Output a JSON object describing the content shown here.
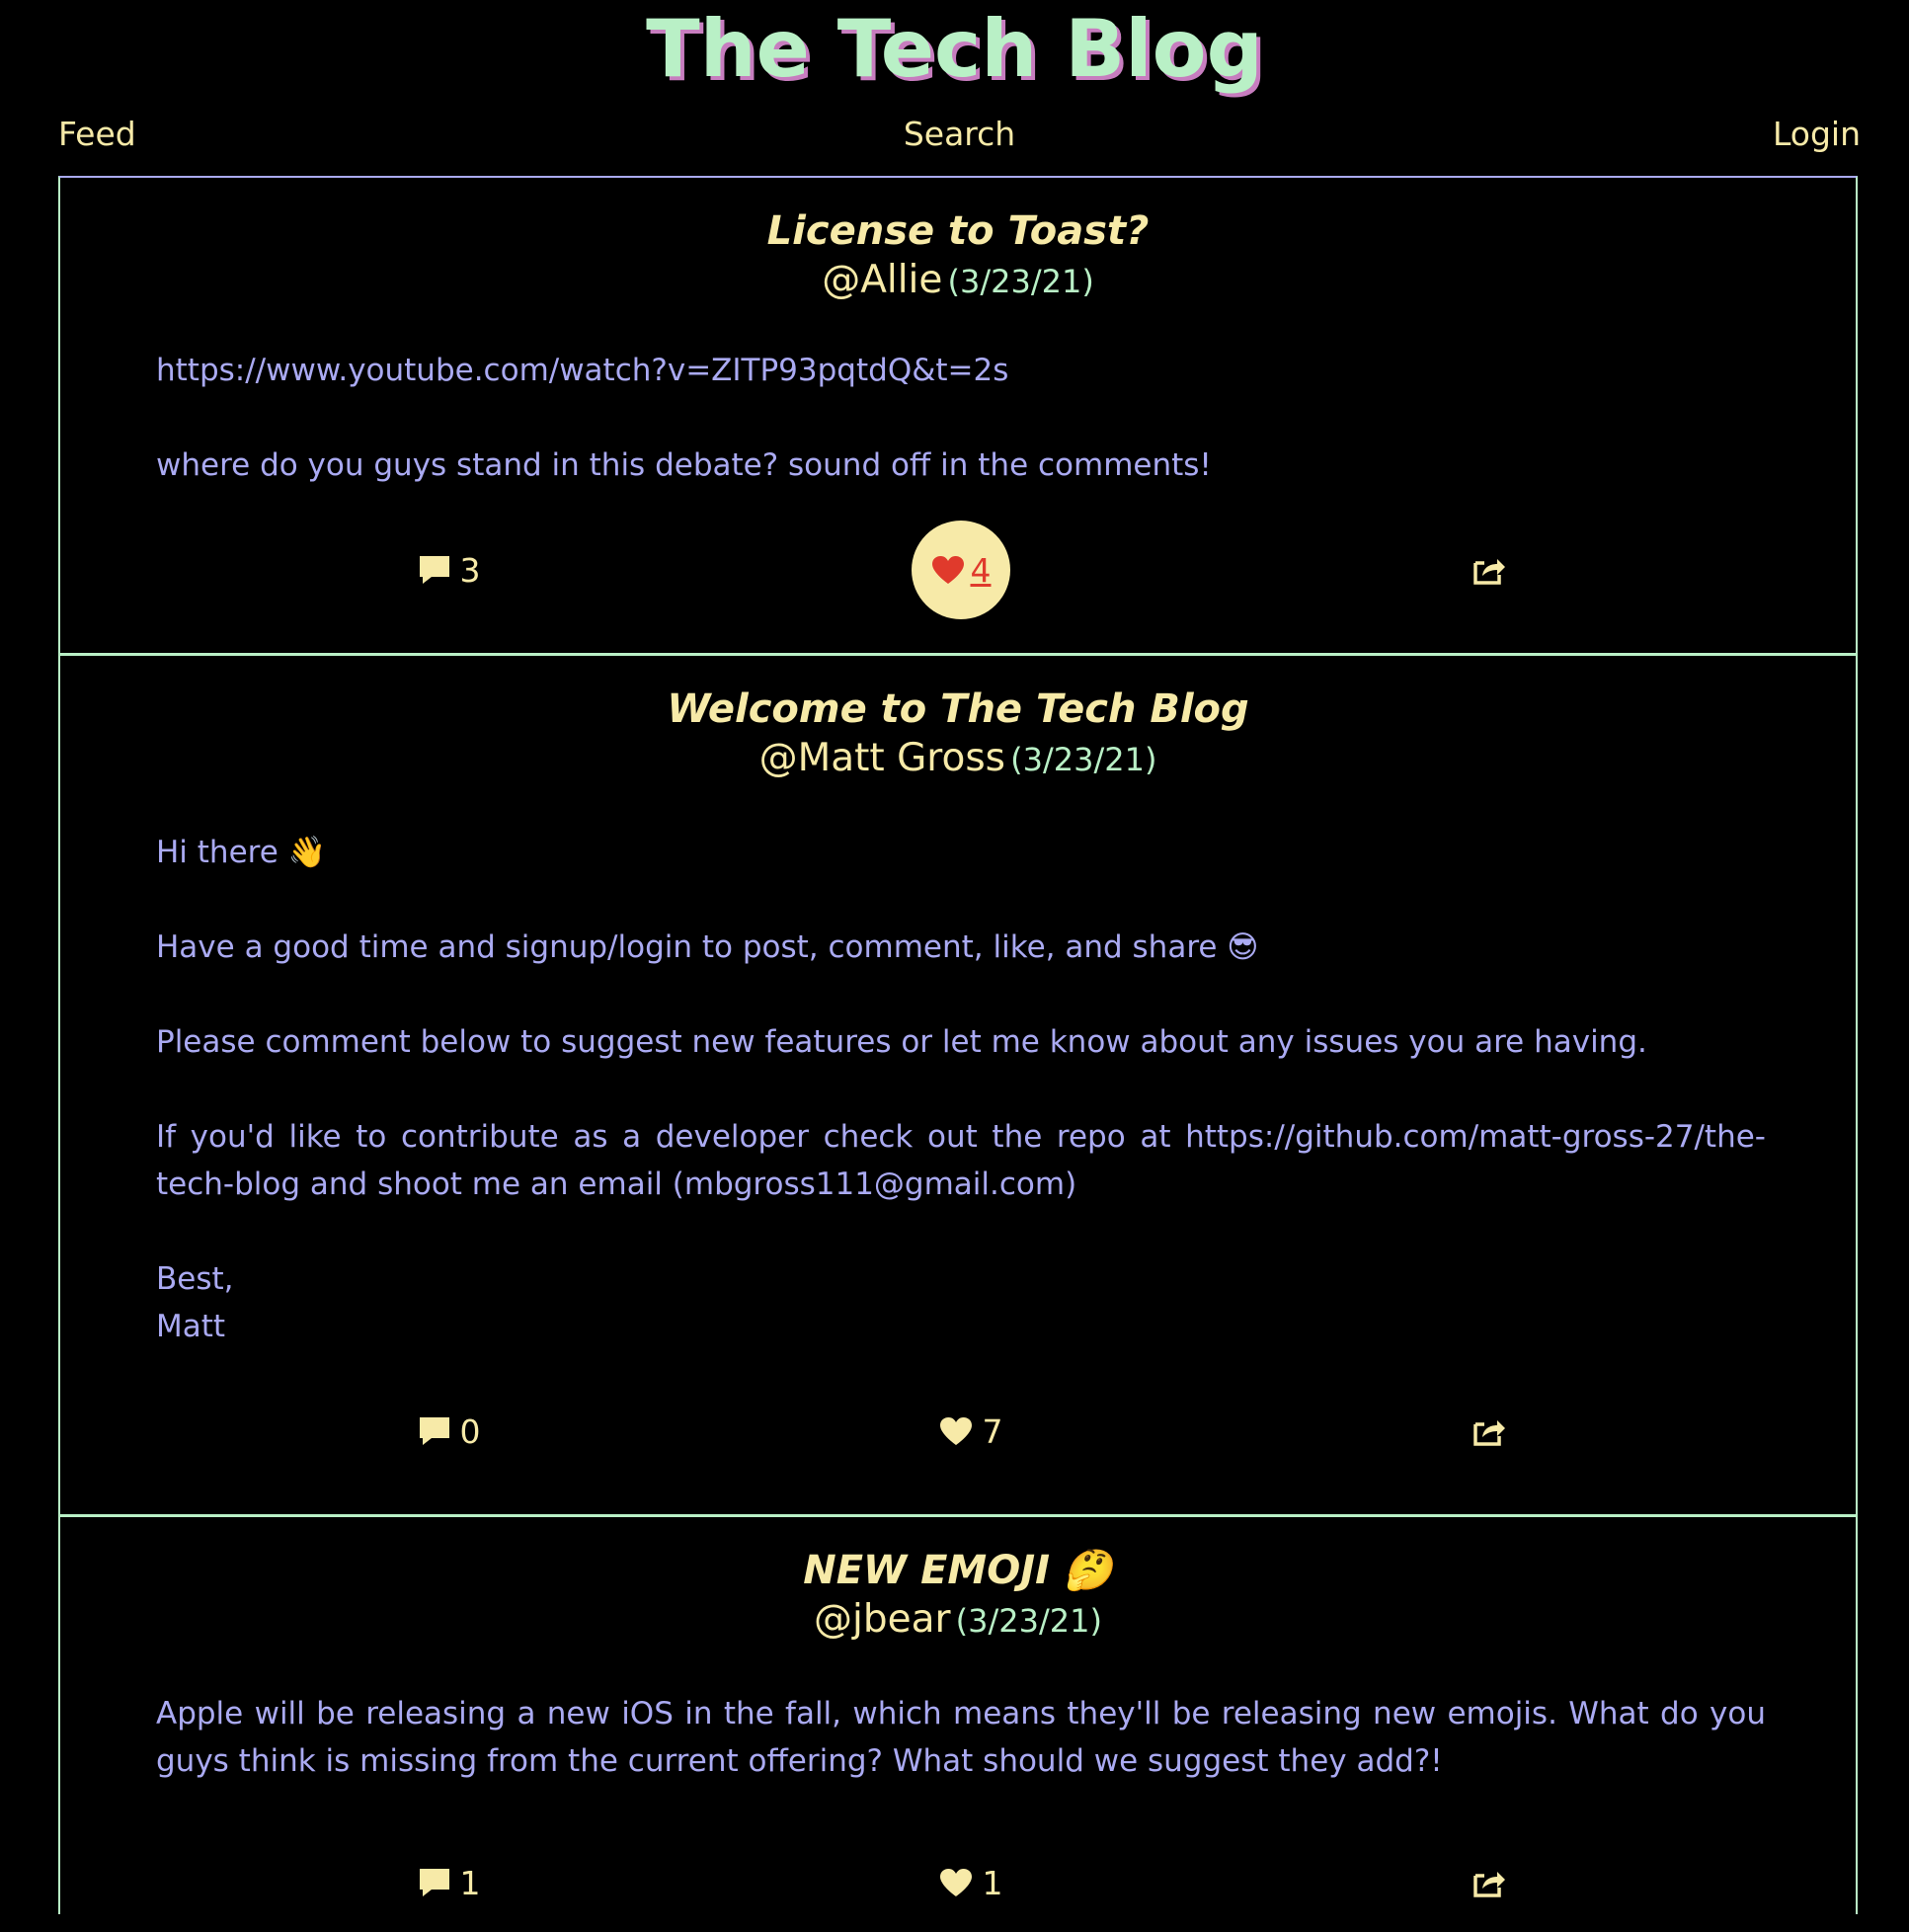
{
  "site": {
    "title": "The Tech Blog"
  },
  "nav": {
    "feed": "Feed",
    "search": "Search",
    "login": "Login"
  },
  "posts": [
    {
      "title": "License to Toast?",
      "author": "@Allie",
      "date": "(3/23/21)",
      "body": [
        "https://www.youtube.com/watch?v=ZITP93pqtdQ&t=2s",
        "where do you guys stand in this debate? sound off in the comments!"
      ],
      "comments": "3",
      "likes": "4",
      "liked": true
    },
    {
      "title": "Welcome to The Tech Blog",
      "author": "@Matt Gross",
      "date": "(3/23/21)",
      "body": [
        "Hi there 👋",
        "Have a good time and signup/login to post, comment, like, and share 😎",
        "Please comment below to suggest new features or let me know about any issues you are having.",
        "If you'd like to contribute as a developer check out the repo at https://github.com/matt-gross-27/the-tech-blog and shoot me an email (mbgross111@gmail.com)",
        "Best,",
        "Matt"
      ],
      "comments": "0",
      "likes": "7",
      "liked": false
    },
    {
      "title": "NEW EMOJI 🤔",
      "author": "@jbear",
      "date": "(3/23/21)",
      "body": [
        "Apple will be releasing a new iOS in the fall, which means they'll be releasing new emojis. What do you guys think is missing from the current offering? What should we suggest they add?!"
      ],
      "comments": "1",
      "likes": "1",
      "liked": false
    }
  ],
  "icons": {
    "comment": "comment-icon",
    "like": "heart-icon",
    "share": "share-icon"
  },
  "colors": {
    "background": "#000000",
    "title_green": "#b9f0c6",
    "title_shadow": "#c77dbf",
    "accent_yellow": "#f7eaa8",
    "body_text": "#aaaaf2",
    "liked_red": "#e03a2c"
  }
}
